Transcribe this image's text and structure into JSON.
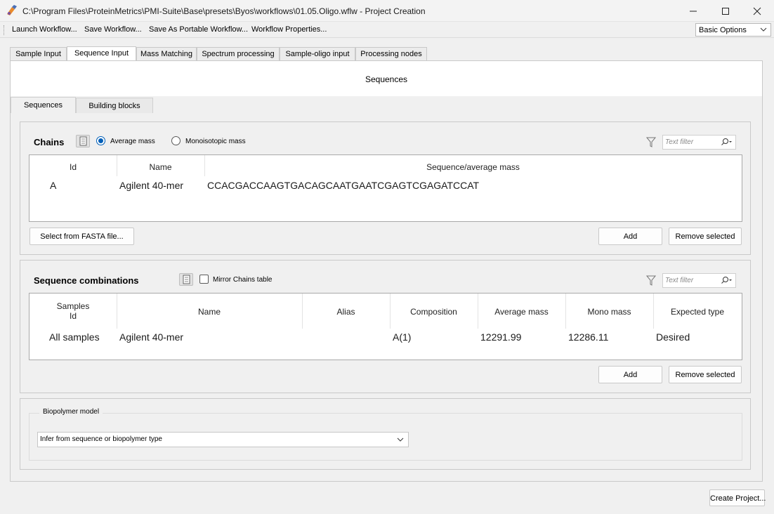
{
  "window": {
    "title": "C:\\Program Files\\ProteinMetrics\\PMI-Suite\\Base\\presets\\Byos\\workflows\\01.05.Oligo.wflw - Project Creation"
  },
  "menu": {
    "items": [
      "Launch Workflow...",
      "Save Workflow...",
      "Save As Portable Workflow...",
      "Workflow Properties..."
    ],
    "options_select": "Basic Options"
  },
  "tabs": [
    "Sample Input",
    "Sequence Input",
    "Mass Matching",
    "Spectrum processing",
    "Sample-oligo input",
    "Processing nodes"
  ],
  "active_tab": "Sequence Input",
  "page_title": "Sequences",
  "subtabs": [
    "Sequences",
    "Building blocks"
  ],
  "chains": {
    "title": "Chains",
    "radio_average": "Average mass",
    "radio_mono": "Monoisotopic mass",
    "selected_mass": "Average mass",
    "filter_placeholder": "Text filter",
    "columns": [
      "Id",
      "Name",
      "Sequence/average mass"
    ],
    "rows": [
      {
        "id": "A",
        "name": "Agilent 40-mer",
        "sequence": "CCACGACCAAGTGACAGCAATGAATCGAGTCGAGATCCAT"
      }
    ],
    "fasta_button": "Select from FASTA file...",
    "add_button": "Add",
    "remove_button": "Remove selected"
  },
  "combinations": {
    "title": "Sequence combinations",
    "mirror_label": "Mirror Chains table",
    "mirror_checked": false,
    "filter_placeholder": "Text filter",
    "columns": [
      "Samples Id",
      "Name",
      "Alias",
      "Composition",
      "Average mass",
      "Mono mass",
      "Expected type"
    ],
    "samples_header_line1": "Samples",
    "samples_header_line2": "Id",
    "rows": [
      {
        "samples": "All samples",
        "name": "Agilent 40-mer",
        "alias": "",
        "composition": "A(1)",
        "average_mass": "12291.99",
        "mono_mass": "12286.11",
        "expected_type": "Desired"
      }
    ],
    "add_button": "Add",
    "remove_button": "Remove selected"
  },
  "biopolymer": {
    "label": "Biopolymer model",
    "value": "Infer from sequence or biopolymer type"
  },
  "create_button": "Create Project...",
  "colors": {
    "accent": "#005fb8",
    "panel": "#f0f0f0",
    "white": "#ffffff",
    "border": "#c9c9c9"
  }
}
